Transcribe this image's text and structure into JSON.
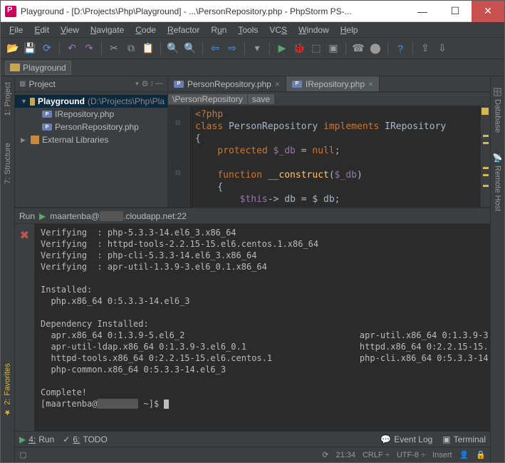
{
  "titlebar": {
    "text": "Playground - [D:\\Projects\\Php\\Playground] - ...\\PersonRepository.php - PhpStorm PS-..."
  },
  "menu": [
    "File",
    "Edit",
    "View",
    "Navigate",
    "Code",
    "Refactor",
    "Run",
    "Tools",
    "VCS",
    "Window",
    "Help"
  ],
  "breadcrumb": "Playground",
  "left_tools": [
    {
      "num": "1:",
      "label": "Project"
    },
    {
      "num": "7:",
      "label": "Structure"
    },
    {
      "num": "2:",
      "label": "Favorites"
    }
  ],
  "right_tools": [
    "Database",
    "Remote Host"
  ],
  "project_panel": {
    "title": "Project",
    "root": {
      "label": "Playground",
      "path": "(D:\\Projects\\Php\\Pla"
    },
    "files": [
      "IRepository.php",
      "PersonRepository.php"
    ],
    "external": "External Libraries"
  },
  "editor": {
    "tabs": [
      {
        "label": "PersonRepository.php",
        "active": true
      },
      {
        "label": "IRepository.php",
        "active": false
      }
    ],
    "path_segments": [
      "PersonRepository",
      "save"
    ],
    "code_lines": [
      {
        "t": "<?php",
        "c": "kw"
      },
      {
        "t": "class PersonRepository implements IRepository",
        "tokens": [
          [
            "class ",
            "kw"
          ],
          [
            "PersonRepository ",
            "cls"
          ],
          [
            "implements ",
            "kw"
          ],
          [
            "IRepository",
            "cls"
          ]
        ]
      },
      {
        "t": "{",
        "c": "op"
      },
      {
        "t": "    protected $_db = null;",
        "tokens": [
          [
            "    protected ",
            "kw"
          ],
          [
            "$_db",
            "var"
          ],
          [
            " = ",
            "op"
          ],
          [
            "null",
            "lit"
          ],
          [
            ";",
            "op"
          ]
        ]
      },
      {
        "t": ""
      },
      {
        "t": "    function __construct($_db)",
        "tokens": [
          [
            "    function ",
            "kw"
          ],
          [
            "__construct",
            "fn"
          ],
          [
            "(",
            "op"
          ],
          [
            "$_db",
            "var"
          ],
          [
            ")",
            "op"
          ]
        ]
      },
      {
        "t": "    {",
        "c": "op"
      },
      {
        "t": "        $this-> db = $ db;",
        "tokens": [
          [
            "        ",
            ""
          ],
          [
            "$this",
            "var"
          ],
          [
            "-> db = $ db;",
            "op"
          ]
        ]
      }
    ]
  },
  "run": {
    "title_prefix": "Run",
    "server_prefix": "maartenba@",
    "server_suffix": ".cloudapp.net:22",
    "console": "Verifying  : php-5.3.3-14.el6_3.x86_64\nVerifying  : httpd-tools-2.2.15-15.el6.centos.1.x86_64\nVerifying  : php-cli-5.3.3-14.el6_3.x86_64\nVerifying  : apr-util-1.3.9-3.el6_0.1.x86_64\n\nInstalled:\n  php.x86_64 0:5.3.3-14.el6_3\n\nDependency Installed:\n  apr.x86_64 0:1.3.9-5.el6_2                                  apr-util.x86_64 0:1.3.9-3\n  apr-util-ldap.x86_64 0:1.3.9-3.el6_0.1                      httpd.x86_64 0:2.2.15-15.\n  httpd-tools.x86_64 0:2.2.15-15.el6.centos.1                 php-cli.x86_64 0:5.3.3-14\n  php-common.x86_64 0:5.3.3-14.el6_3\n\nComplete!",
    "prompt_user": "[maartenba@",
    "prompt_tail": " ~]$ "
  },
  "bottom_tools": {
    "run": {
      "num": "4:",
      "label": "Run"
    },
    "todo": {
      "num": "6:",
      "label": "TODO"
    },
    "event_log": "Event Log",
    "terminal": "Terminal"
  },
  "status": {
    "time": "21:34",
    "line_sep": "CRLF",
    "encoding": "UTF-8",
    "insert": "Insert"
  }
}
